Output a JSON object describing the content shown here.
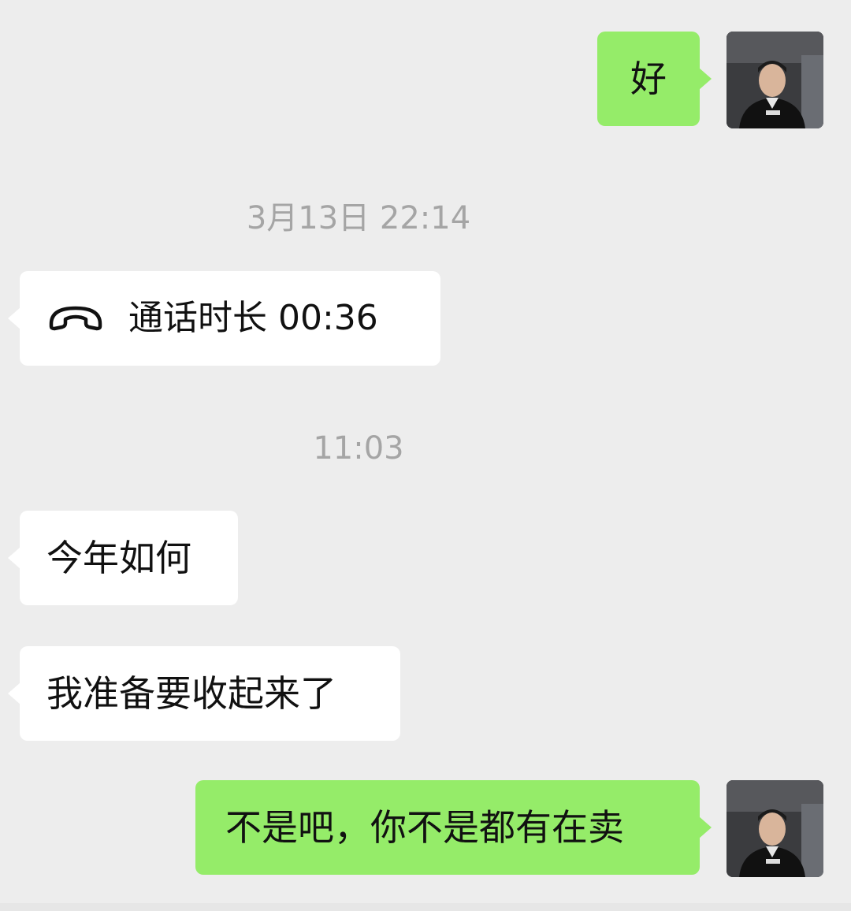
{
  "messages": [
    {
      "id": "m1",
      "side": "out",
      "text": "好"
    },
    {
      "id": "t1",
      "type": "timestamp",
      "text": "3月13日 22:14"
    },
    {
      "id": "m2",
      "side": "in",
      "type": "call",
      "icon": "phone-hangup-icon",
      "text": "通话时长 00:36"
    },
    {
      "id": "t2",
      "type": "timestamp",
      "text": "11:03"
    },
    {
      "id": "m3",
      "side": "in",
      "text": "今年如何"
    },
    {
      "id": "m4",
      "side": "in",
      "text": "我准备要收起来了"
    },
    {
      "id": "m5",
      "side": "out",
      "text": "不是吧，你不是都有在卖"
    }
  ],
  "colors": {
    "background": "#ededed",
    "incoming_bubble": "#ffffff",
    "outgoing_bubble": "#95ec69",
    "timestamp_text": "#a5a5a5"
  }
}
